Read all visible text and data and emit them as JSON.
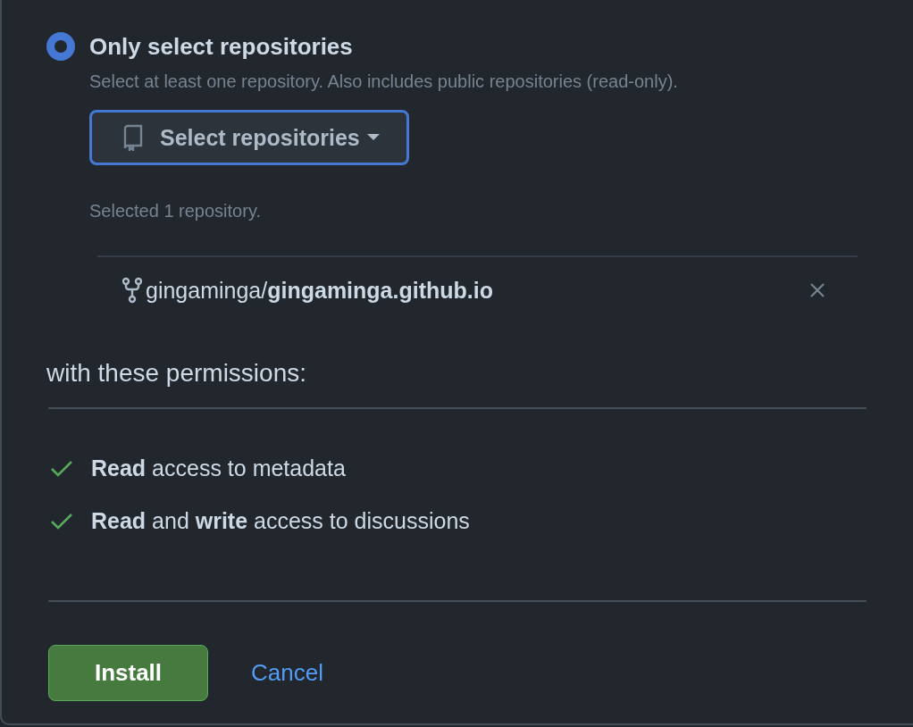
{
  "repository_access": {
    "option": {
      "label": "Only select repositories",
      "selected": true,
      "description": "Select at least one repository. Also includes public repositories (read-only)."
    },
    "select_button": "Select repositories",
    "selected_count": "Selected 1 repository.",
    "repositories": [
      {
        "name": "gingaminga/**gingaminga.github.io**"
      }
    ]
  },
  "permissions": {
    "heading": "with these permissions:",
    "items": [
      {
        "text": "**Read** access to metadata"
      },
      {
        "text": "**Read** and **write** access to discussions"
      }
    ]
  },
  "actions": {
    "install": "Install",
    "cancel": "Cancel"
  }
}
